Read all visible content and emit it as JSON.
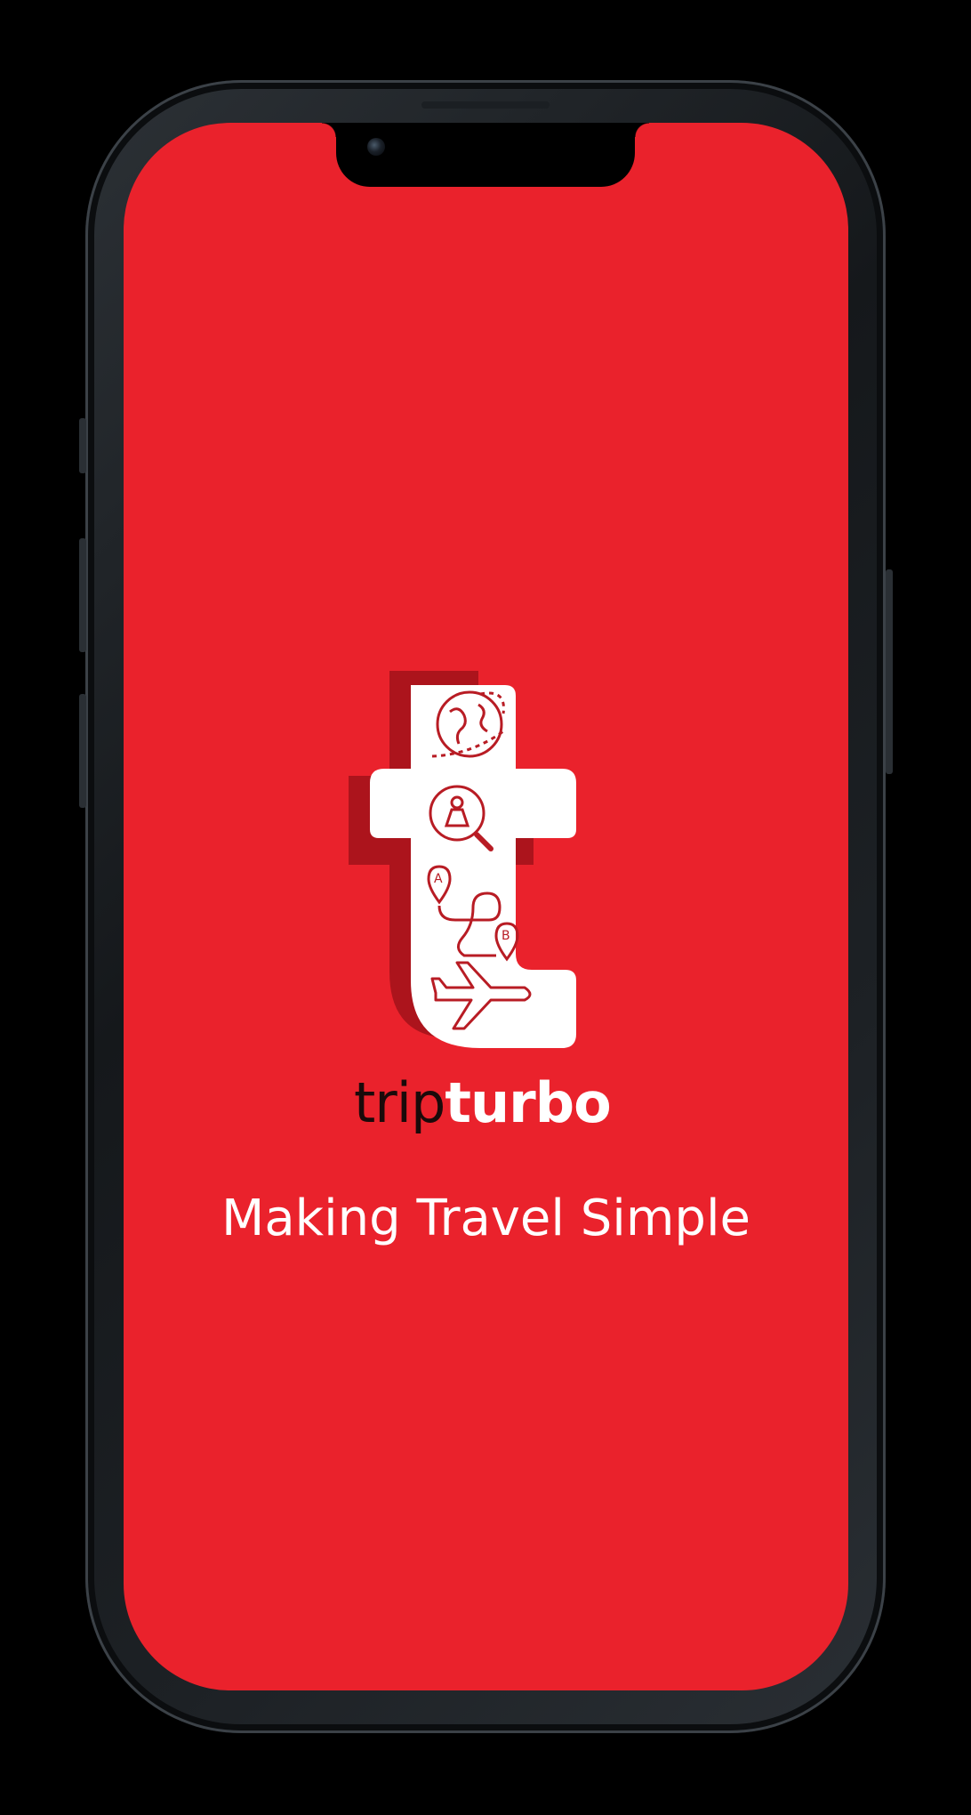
{
  "app": {
    "brand_part1": "trip",
    "brand_part2": "turbo",
    "tagline": "Making Travel Simple"
  },
  "theme": {
    "background": "#EA222C",
    "logo_fill": "#FFFFFF",
    "logo_shadow": "#A5131B",
    "brand_dark": "#1A0A0A"
  },
  "icons": {
    "logo": "tripturbo-t-logo",
    "globe": "globe-icon",
    "search": "map-search-icon",
    "route": "route-a-to-b-icon",
    "plane": "airplane-icon",
    "camera": "front-camera"
  }
}
